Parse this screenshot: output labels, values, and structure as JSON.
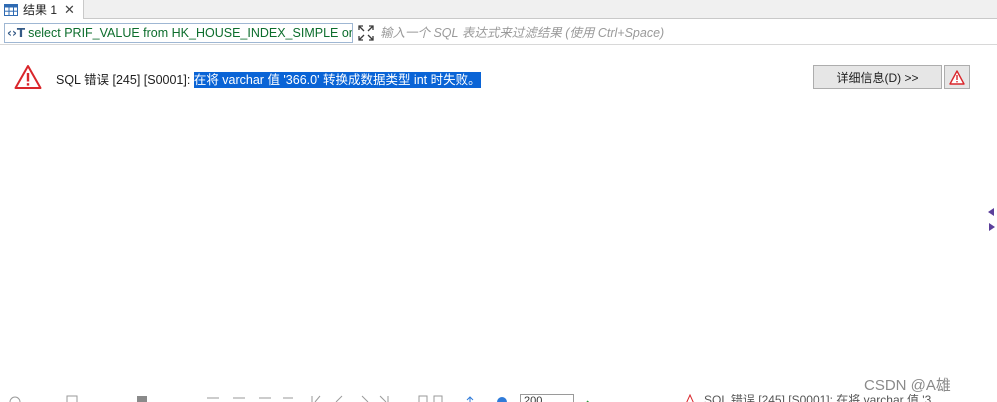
{
  "tab": {
    "label": "结果 1",
    "close_glyph": "✕"
  },
  "filter": {
    "sql_icon": "‹›T",
    "query_text": "select PRIF_VALUE from HK_HOUSE_INDEX_SIMPLE order by",
    "placeholder": "输入一个 SQL 表达式来过滤结果 (使用 Ctrl+Space)"
  },
  "error": {
    "prefix": "SQL 错误 [245] [S0001]: ",
    "highlight": "在将 varchar 值 '366.0' 转换成数据类型 int 时失败。",
    "details_button": "详细信息(D) >>"
  },
  "bottom": {
    "page_size": "200",
    "status_text": "SQL 错误 [245] [S0001]: 在将 varchar 值 '3"
  },
  "watermark": "CSDN @A雄",
  "colors": {
    "highlight_bg": "#0a64d6",
    "sql_text": "#0c6d2c",
    "error_red": "#d9262b",
    "button_bg": "#e6e6e6"
  },
  "icons": {
    "tab": "grid-icon",
    "expand": "expand-icon",
    "error": "warning-triangle-icon",
    "warn_button": "warning-triangle-icon"
  }
}
